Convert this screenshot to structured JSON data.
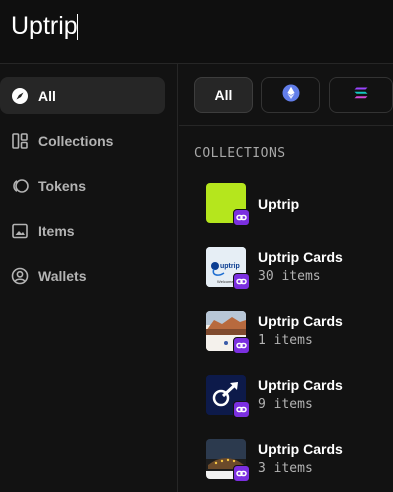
{
  "search": {
    "query": "Uptrip"
  },
  "sidebar": {
    "items": [
      {
        "label": "All",
        "icon": "compass-icon",
        "active": true
      },
      {
        "label": "Collections",
        "icon": "collections-icon"
      },
      {
        "label": "Tokens",
        "icon": "tokens-icon"
      },
      {
        "label": "Items",
        "icon": "image-icon"
      },
      {
        "label": "Wallets",
        "icon": "user-circle-icon"
      }
    ]
  },
  "filters": {
    "chips": [
      {
        "label": "All",
        "active": true
      },
      {
        "icon": "ethereum-icon"
      },
      {
        "icon": "solana-icon"
      }
    ]
  },
  "collections": {
    "title": "COLLECTIONS",
    "items": [
      {
        "name": "Uptrip",
        "count": "",
        "thumb": "lime"
      },
      {
        "name": "Uptrip Cards",
        "count": "30 items",
        "thumb": "uptrip-card"
      },
      {
        "name": "Uptrip Cards",
        "count": "1 items",
        "thumb": "landscape"
      },
      {
        "name": "Uptrip Cards",
        "count": "9 items",
        "thumb": "plane-arrow"
      },
      {
        "name": "Uptrip Cards",
        "count": "3 items",
        "thumb": "dark-scene"
      }
    ],
    "thumb_texts": {
      "uptrip_card_logo": "uptrip",
      "uptrip_card_caption": "Welcome"
    },
    "chain_badge_icon": "chain-link-icon"
  },
  "colors": {
    "accent_purple": "#7b2fe0",
    "lime": "#b5e61d"
  }
}
